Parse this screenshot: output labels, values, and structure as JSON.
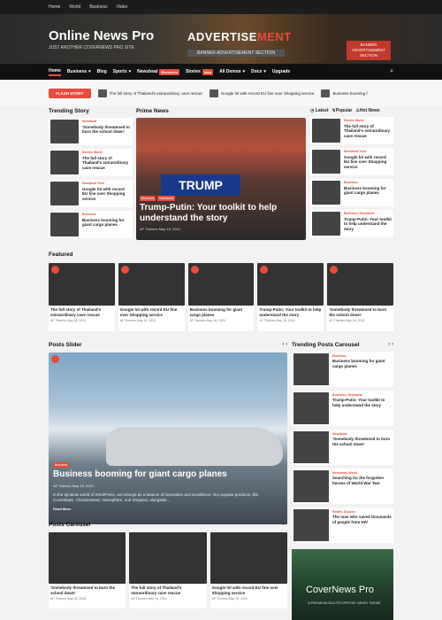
{
  "topbar": {
    "items": [
      "Home",
      "World",
      "Business",
      "Video"
    ]
  },
  "header": {
    "brand_title": "Online News Pro",
    "brand_sub": "JUST ANOTHER COVERNEWS PRO SITE",
    "ad_word_a": "ADVERTISE",
    "ad_word_b": "MENT",
    "ad_sub": "BANNER ADVERTISEMENT SECTION",
    "ad_side": "BANNER ADVERTISEMENT SECTION"
  },
  "nav": {
    "items": [
      "Home",
      "Business",
      "Blog",
      "Sports",
      "Newsbeat",
      "Stories",
      "All Demos",
      "Docs",
      "Upgrade"
    ],
    "newsbeat_badge": "Exclusive",
    "stories_badge": "New"
  },
  "ticker": {
    "flash_label": "FLASH STORY",
    "items": [
      "The full story of Thailand's extraordinary cave rescue",
      "Google hit with record EU fine over Shopping service",
      "Business booming f"
    ]
  },
  "trending": {
    "title": "Trending Story",
    "items": [
      {
        "cat": "Newsbeat",
        "title": "'Somebody threatened to burn the school down'"
      },
      {
        "cat": "Stories World",
        "title": "The full story of Thailand's extraordinary cave rescue"
      },
      {
        "cat": "Newsbeat Tech",
        "title": "Google hit with record EU fine over Shopping service"
      },
      {
        "cat": "Business",
        "title": "Business booming for giant cargo planes"
      }
    ]
  },
  "prime": {
    "title": "Prime News",
    "sign": "TRUMP",
    "tags": [
      "Business",
      "Newsbeat"
    ],
    "headline": "Trump-Putin: Your toolkit to help understand the story",
    "meta": "AF Themes  May 18, 2024"
  },
  "right_tabs": {
    "latest": "Latest",
    "popular": "Popular",
    "hot": "Hot News",
    "items": [
      {
        "cat": "Stories World",
        "title": "The full story of Thailand's extraordinary cave rescue"
      },
      {
        "cat": "Newsbeat Tech",
        "title": "Google hit with record EU fine over Shopping service"
      },
      {
        "cat": "Business",
        "title": "Business booming for giant cargo planes"
      },
      {
        "cat": "Business, Newsbeat",
        "title": "Trump-Putin: Your toolkit to help understand the story"
      }
    ]
  },
  "featured": {
    "title": "Featured",
    "items": [
      {
        "title": "The full story of Thailand's extraordinary cave rescue",
        "meta": "AF Themes  May 18, 2024"
      },
      {
        "title": "Google hit with record EU fine over Shopping service",
        "meta": "AF Themes  May 18, 2024"
      },
      {
        "title": "Business booming for giant cargo planes",
        "meta": "AF Themes  May 18, 2024"
      },
      {
        "title": "Trump-Putin: Your toolkit to help understand the story",
        "meta": "AF Themes  May 18, 2024"
      },
      {
        "title": "'Somebody threatened to burn the school down'",
        "meta": "AF Themes  May 18, 2024"
      }
    ]
  },
  "slider": {
    "title": "Posts Slider",
    "tag": "Business",
    "headline": "Business booming for giant cargo planes",
    "meta": "AF Themes  May 18, 2024",
    "excerpt": "In the dynamic world of WordPress, we emerge as a beacon of innovation and excellence. Our popular products, like CoverNews, ChromeNews, Newsphere, and Shopical, alongside...",
    "read_more": "Read More"
  },
  "trending_carousel": {
    "title": "Trending Posts Carousel",
    "items": [
      {
        "cat": "Business",
        "title": "Business booming for giant cargo planes"
      },
      {
        "cat": "Business, Newsbeat",
        "title": "Trump-Putin: Your toolkit to help understand the story"
      },
      {
        "cat": "Newsbeat",
        "title": "'Somebody threatened to burn the school down'"
      },
      {
        "cat": "Newsbeat, World",
        "title": "Searching for the forgotten heroes of World War Two"
      },
      {
        "cat": "Health, Science",
        "title": "The man who saved thousands of people from HIV"
      }
    ]
  },
  "posts_carousel": {
    "title": "Posts Carousel",
    "items": [
      {
        "title": "'Somebody threatened to burn the school down'",
        "meta": "AF Themes  May 18, 2024"
      },
      {
        "title": "The full story of Thailand's extraordinary cave rescue",
        "meta": "AF Themes  May 18, 2024"
      },
      {
        "title": "Google hit with record EU fine over Shopping service",
        "meta": "AF Themes  May 18, 2024"
      }
    ]
  },
  "bottom_ad": {
    "title": "CoverNews Pro",
    "sub": "A PREMIUM MULTIPURPOSE NEWS THEME"
  }
}
